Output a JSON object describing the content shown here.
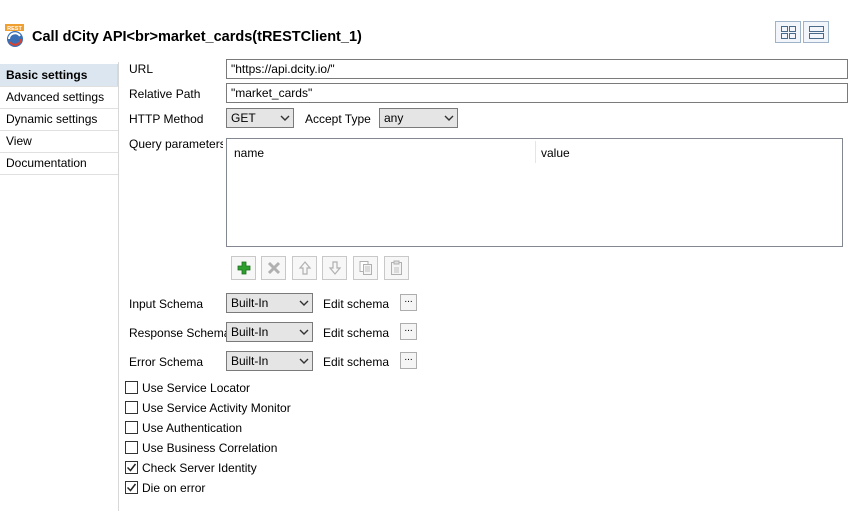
{
  "header": {
    "title": "Call dCity API<br>market_cards(tRESTClient_1)",
    "icon_badge": "REST"
  },
  "sidebar": {
    "items": [
      {
        "label": "Basic settings",
        "active": true
      },
      {
        "label": "Advanced settings",
        "active": false
      },
      {
        "label": "Dynamic settings",
        "active": false
      },
      {
        "label": "View",
        "active": false
      },
      {
        "label": "Documentation",
        "active": false
      }
    ]
  },
  "form": {
    "url": {
      "label": "URL",
      "value": "\"https://api.dcity.io/\""
    },
    "relative_path": {
      "label": "Relative Path",
      "value": "\"market_cards\""
    },
    "http_method": {
      "label": "HTTP Method",
      "value": "GET"
    },
    "accept_type": {
      "label": "Accept Type",
      "value": "any"
    },
    "query_parameters": {
      "label": "Query parameters",
      "columns": [
        "name",
        "value"
      ],
      "rows": []
    },
    "input_schema": {
      "label": "Input Schema",
      "value": "Built-In",
      "edit_label": "Edit schema",
      "button_label": "..."
    },
    "response_schema": {
      "label": "Response Schema",
      "value": "Built-In",
      "edit_label": "Edit schema",
      "button_label": "..."
    },
    "error_schema": {
      "label": "Error Schema",
      "value": "Built-In",
      "edit_label": "Edit schema",
      "button_label": "..."
    }
  },
  "table_toolbar": [
    {
      "name": "add-row-button",
      "icon": "plus-icon"
    },
    {
      "name": "remove-row-button",
      "icon": "x-icon"
    },
    {
      "name": "move-up-button",
      "icon": "arrow-up-icon"
    },
    {
      "name": "move-down-button",
      "icon": "arrow-down-icon"
    },
    {
      "name": "copy-button",
      "icon": "copy-icon"
    },
    {
      "name": "paste-button",
      "icon": "paste-icon"
    }
  ],
  "options": [
    {
      "label": "Use Service Locator",
      "checked": false
    },
    {
      "label": "Use Service Activity Monitor",
      "checked": false
    },
    {
      "label": "Use Authentication",
      "checked": false
    },
    {
      "label": "Use Business Correlation",
      "checked": false
    },
    {
      "label": "Check Server Identity",
      "checked": true
    },
    {
      "label": "Die on error",
      "checked": true
    }
  ],
  "colors": {
    "sidebar_active_bg": "#dce6f1",
    "add_icon": "#2e9e2e",
    "disabled_icon": "#b0b0b0"
  }
}
